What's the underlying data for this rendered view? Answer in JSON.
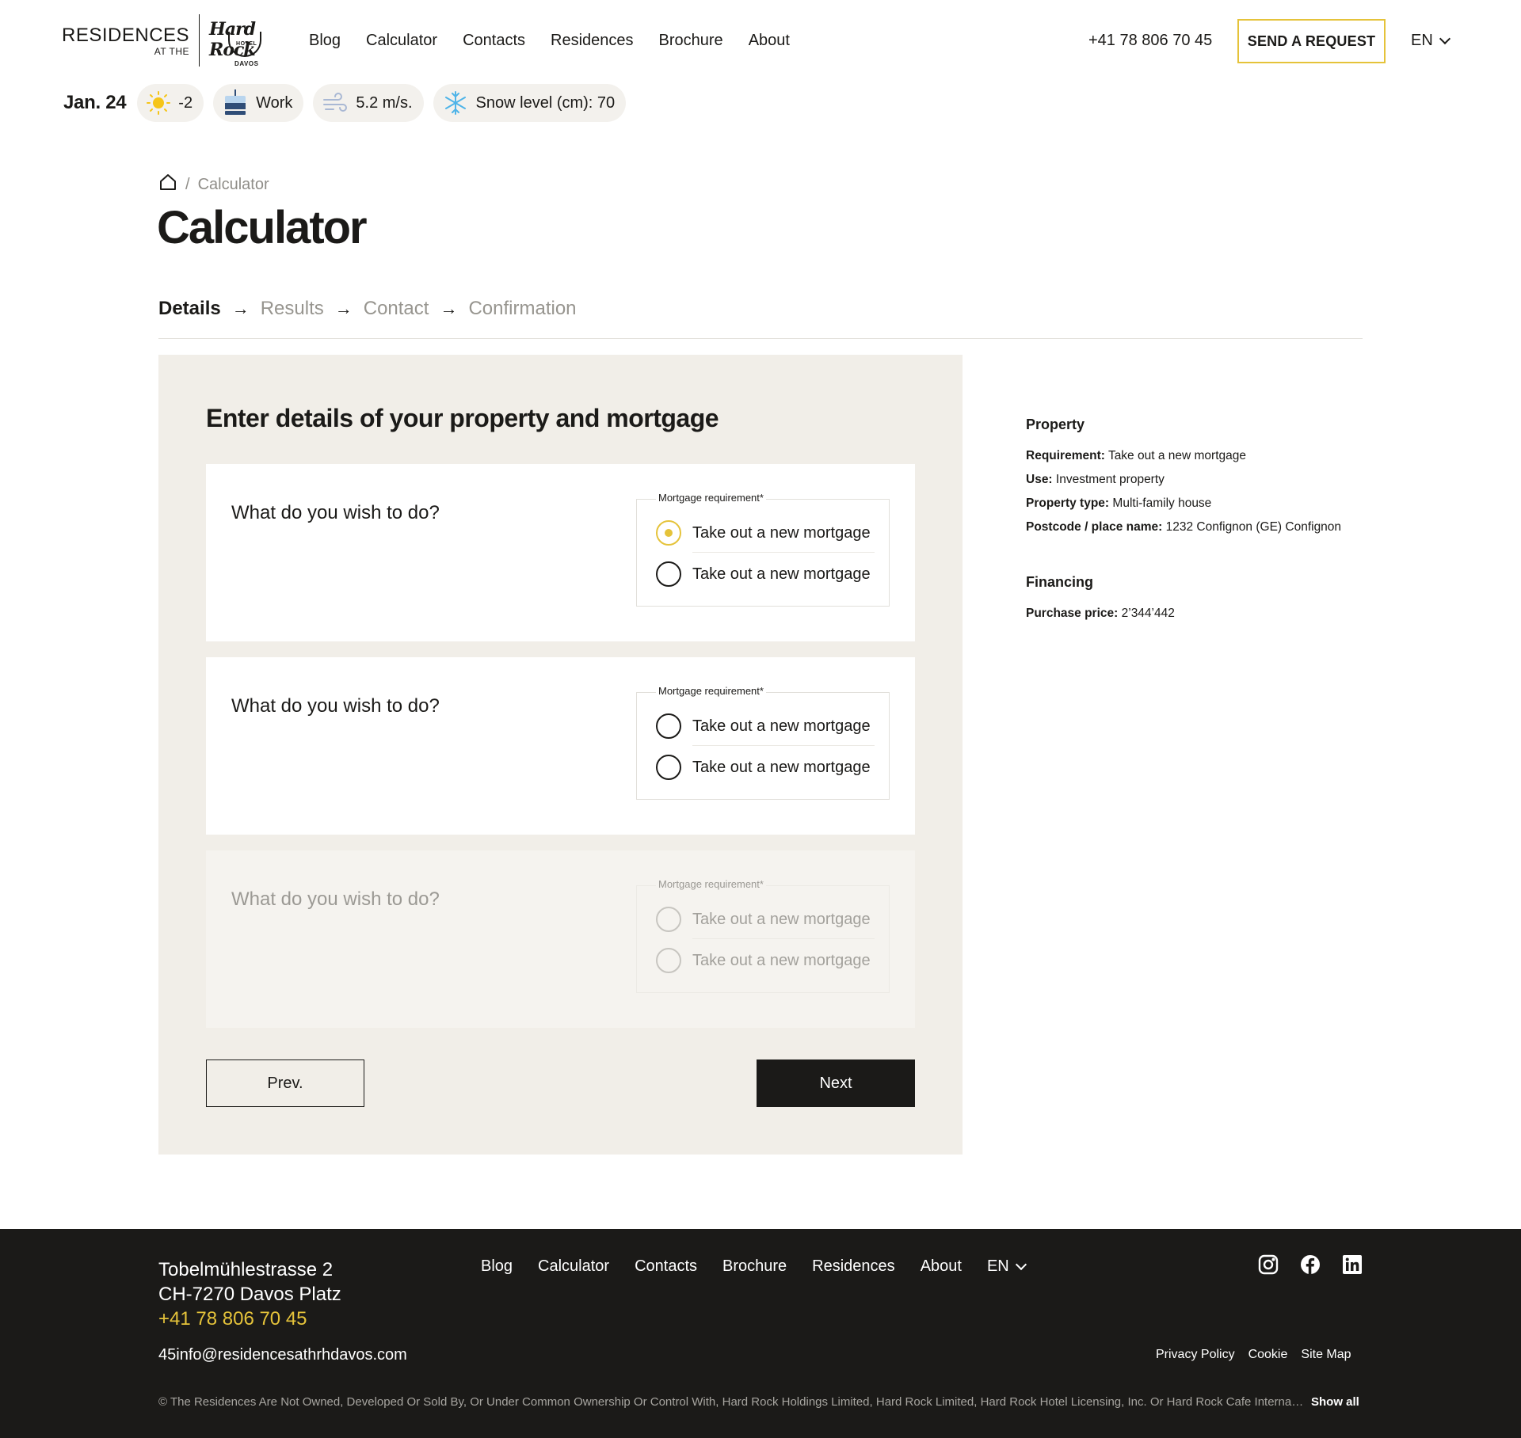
{
  "header": {
    "logo": {
      "line1": "RESIDENCES",
      "line2": "AT THE",
      "brand": "Hard Rock",
      "hotel": "HOTEL",
      "location": "DAVOS"
    },
    "nav": [
      "Blog",
      "Calculator",
      "Contacts",
      "Residences",
      "Brochure",
      "About"
    ],
    "phone": "+41 78 806 70 45",
    "cta": "SEND A REQUEST",
    "language": "EN"
  },
  "weather": {
    "date": "Jan. 24",
    "temperature": "-2",
    "lift_status": "Work",
    "wind": "5.2 m/s.",
    "snow": "Snow level (cm): 70"
  },
  "breadcrumb": {
    "current": "Calculator"
  },
  "page": {
    "title": "Calculator"
  },
  "steps": [
    "Details",
    "Results",
    "Contact",
    "Confirmation"
  ],
  "form": {
    "title": "Enter details of your property and mortgage",
    "questions": [
      {
        "question": "What do you wish to do?",
        "legend": "Mortgage requirement*",
        "options": [
          "Take out a new mortgage",
          "Take out a new mortgage"
        ],
        "selected": 0,
        "disabled": false
      },
      {
        "question": "What do you wish to do?",
        "legend": "Mortgage requirement*",
        "options": [
          "Take out a new mortgage",
          "Take out a new mortgage"
        ],
        "selected": null,
        "disabled": false
      },
      {
        "question": "What do you wish to do?",
        "legend": "Mortgage requirement*",
        "options": [
          "Take out a new mortgage",
          "Take out a new mortgage"
        ],
        "selected": null,
        "disabled": true
      }
    ],
    "prev_label": "Prev.",
    "next_label": "Next"
  },
  "summary": {
    "property_heading": "Property",
    "property_rows": [
      {
        "label": "Requirement:",
        "value": "Take out a new mortgage"
      },
      {
        "label": "Use:",
        "value": "Investment property"
      },
      {
        "label": "Property type:",
        "value": "Multi-family house"
      },
      {
        "label": "Postcode / place name:",
        "value": "1232 Confignon (GE) Confignon"
      }
    ],
    "financing_heading": "Financing",
    "financing_rows": [
      {
        "label": "Purchase price:",
        "value": "2’344’442"
      }
    ]
  },
  "footer": {
    "address_line1": "Tobelmühlestrasse 2",
    "address_line2": "CH-7270 Davos Platz",
    "phone": "+41 78 806 70 45",
    "email": "45info@residencesathrhdavos.com",
    "nav": [
      "Blog",
      "Calculator",
      "Contacts",
      "Brochure",
      "Residences",
      "About"
    ],
    "language": "EN",
    "legal": [
      "Privacy Policy",
      "Cookie",
      "Site Map"
    ],
    "copyright": "© The Residences Are Not Owned, Developed Or Sold By, Or Under Common Ownership Or Control With, Hard Rock Holdings Limited, Hard Rock Limited, Hard Rock Hotel Licensing, Inc. Or Hard Rock Cafe International",
    "show_all": "Show all"
  },
  "icons": {
    "temperature": "sun-icon",
    "lift": "ski-lift-icon",
    "wind": "wind-icon",
    "snow": "snowflake-icon",
    "breadcrumb_home": "home-icon",
    "social": [
      "instagram-icon",
      "facebook-icon",
      "linkedin-icon"
    ]
  },
  "colors": {
    "accent": "#e5c33a",
    "dark": "#1b1a18",
    "panel": "#f1eee8",
    "pill": "#f3f1ed"
  }
}
